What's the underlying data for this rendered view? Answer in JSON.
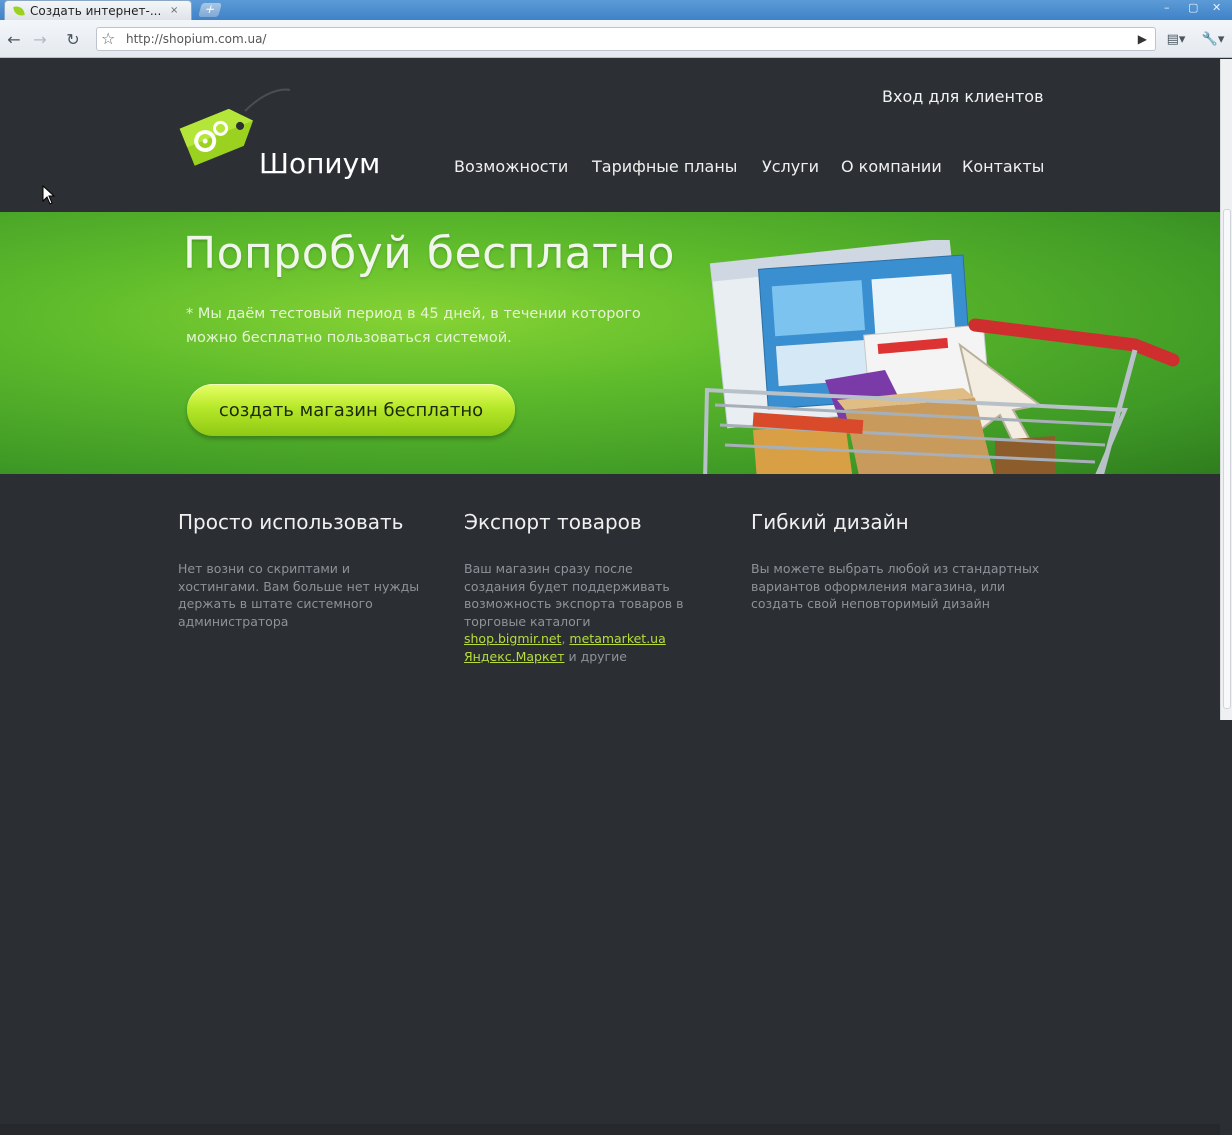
{
  "browser": {
    "tab_title": "Создать интернет-...",
    "tab_close": "×",
    "newtab": "+",
    "url": "http://shopium.com.ua/",
    "back_icon": "←",
    "forward_icon": "→",
    "reload_icon": "↻",
    "star_icon": "☆",
    "go_icon": "▶",
    "page_icon": "▤▾",
    "wrench_icon": "🔧▾",
    "minimize": "–",
    "maximize": "▢",
    "close": "✕"
  },
  "site": {
    "logo_text": "Шопиум",
    "client_login": "Вход для клиентов",
    "nav": [
      "Возможности",
      "Тарифные планы",
      "Услуги",
      "О компании",
      "Контакты"
    ],
    "hero": {
      "title": "Попробуй бесплатно",
      "subtitle": "* Мы даём тестовый период в 45 дней, в течении которого можно бесплатно пользоваться системой.",
      "cta": "создать магазин бесплатно"
    },
    "features": [
      {
        "title": "Просто использовать",
        "text": "Нет возни со скриптами и хостингами. Вам больше нет нужды держать в штате системного администратора"
      },
      {
        "title": "Экспорт товаров",
        "text": "Ваш магазин сразу после создания будет поддерживать возможность экспорта товаров в торговые каталоги",
        "link1": "shop.bigmir.net",
        "sep": ", ",
        "link2": "metamarket.ua",
        "link3": "Яндекс.Маркет",
        "tail": " и другие"
      },
      {
        "title": "Гибкий дизайн",
        "text": "Вы можете выбрать любой из стандартных вариантов оформления магазина, или создать свой неповторимый дизайн"
      }
    ]
  },
  "colors": {
    "accent_green": "#8fc914",
    "header_bg": "#2c2f33",
    "link": "#b7dd3c"
  }
}
